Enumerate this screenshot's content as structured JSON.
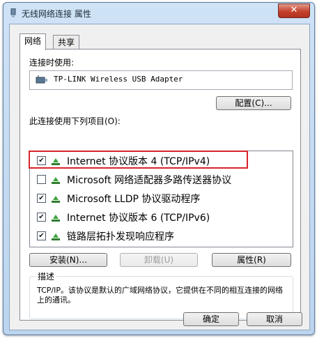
{
  "window": {
    "title": "无线网络连接 属性",
    "close_symbol": "✕"
  },
  "tabs": [
    {
      "label": "网络",
      "active": true
    },
    {
      "label": "共享",
      "active": false
    }
  ],
  "connect_using": {
    "label": "连接时使用:",
    "adapter": "TP-LINK Wireless USB Adapter",
    "configure_button": "配置(C)..."
  },
  "items_section": {
    "label": "此连接使用下列项目(O):",
    "items": [
      {
        "label": "Internet 协议版本 4 (TCP/IPv4)",
        "checked": true,
        "mark": "✔",
        "highlighted": true
      },
      {
        "label": "Microsoft 网络适配器多路传送器协议",
        "checked": false,
        "mark": ""
      },
      {
        "label": "Microsoft LLDP 协议驱动程序",
        "checked": true,
        "mark": "✔"
      },
      {
        "label": "Internet 协议版本 6 (TCP/IPv6)",
        "checked": true,
        "mark": "✔"
      },
      {
        "label": "链路层拓扑发现响应程序",
        "checked": true,
        "mark": "✔"
      }
    ]
  },
  "action_buttons": {
    "install": "安装(N)...",
    "uninstall": "卸载(U)",
    "properties": "属性(R)"
  },
  "description": {
    "label": "描述",
    "text": "TCP/IP。该协议是默认的广域网络协议，它提供在不同的相互连接的网络上的通讯。"
  },
  "footer": {
    "ok": "确定",
    "cancel": "取消"
  },
  "colors": {
    "highlight_border": "#d8232a",
    "title_bar": "#cfe2f6",
    "close_button": "#c4412c"
  }
}
